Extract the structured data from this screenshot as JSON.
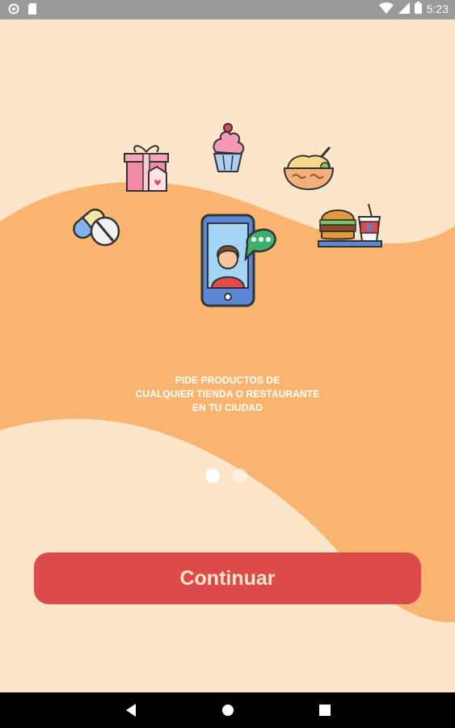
{
  "status_bar": {
    "time": "5:23"
  },
  "slide": {
    "lines": [
      "PIDE PRODUCTOS DE",
      "CUALQUIER TIENDA O RESTAURANTE",
      "EN TU CIUDAD"
    ]
  },
  "pager": {
    "count": 2,
    "active_index": 0
  },
  "continue_button": {
    "label": "Continuar"
  },
  "colors": {
    "background": "#fde5c9",
    "wave": "#f9b56f",
    "button": "#dc4a4b"
  }
}
